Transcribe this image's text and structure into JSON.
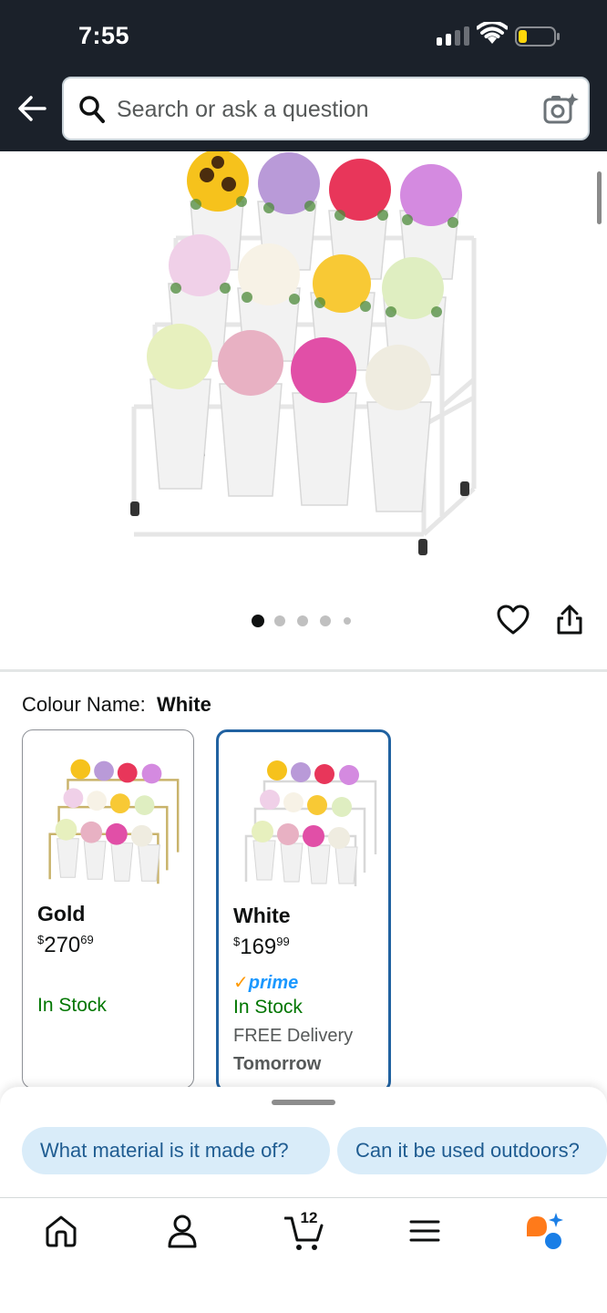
{
  "status_bar": {
    "time": "7:55"
  },
  "search": {
    "placeholder": "Search or ask a question"
  },
  "carousel": {
    "page_count": 5,
    "active_index": 0
  },
  "colour": {
    "label": "Colour Name:",
    "selected": "White"
  },
  "variants": [
    {
      "name": "Gold",
      "price_symbol": "$",
      "price_whole": "270",
      "price_fraction": "69",
      "availability": "In Stock",
      "frame_color": "#c9b36b"
    },
    {
      "name": "White",
      "price_symbol": "$",
      "price_whole": "169",
      "price_fraction": "99",
      "prime": "prime",
      "availability": "In Stock",
      "delivery": "FREE Delivery",
      "delivery_day": "Tomorrow",
      "frame_color": "#e8e8e8"
    }
  ],
  "suggestions": [
    "What material is it made of?",
    "Can it be used outdoors?"
  ],
  "nav": {
    "cart_count": "12",
    "items": [
      "home-icon",
      "account-icon",
      "cart-icon",
      "menu-icon",
      "rufus-icon"
    ]
  },
  "colors": {
    "header_bg": "#1b212a",
    "selected_border": "#2162a1",
    "in_stock": "#007600",
    "prime": "#1a98ff",
    "chip_bg": "#d9ecf9",
    "chip_text": "#1f5c91"
  }
}
